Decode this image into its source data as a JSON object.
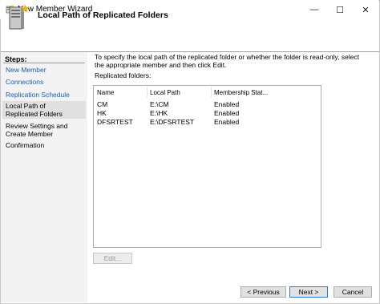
{
  "window": {
    "title": "New Member Wizard",
    "controls": {
      "minimize": "—",
      "maximize": "☐",
      "close": "✕"
    }
  },
  "header": {
    "title": "Local Path of Replicated Folders",
    "icon": "server-icon"
  },
  "steps": {
    "heading": "Steps:",
    "items": [
      {
        "label": "New Member",
        "style": "link"
      },
      {
        "label": "Connections",
        "style": "link"
      },
      {
        "label": "Replication Schedule",
        "style": "link"
      },
      {
        "label": "Local Path of Replicated Folders",
        "style": "current"
      },
      {
        "label": "Review Settings and Create Member",
        "style": "plain"
      },
      {
        "label": "Confirmation",
        "style": "plain"
      }
    ]
  },
  "content": {
    "instructions": "To specify the local path of the replicated folder or whether the folder is read-only, select the appropriate member and then click Edit.",
    "list_label": "Replicated folders:",
    "columns": [
      "Name",
      "Local Path",
      "Membership Stat..."
    ],
    "rows": [
      {
        "name": "CM",
        "path": "E:\\CM",
        "status": "Enabled"
      },
      {
        "name": "HK",
        "path": "E:\\HK",
        "status": "Enabled"
      },
      {
        "name": "DFSRTEST",
        "path": "E:\\DFSRTEST",
        "status": "Enabled"
      }
    ],
    "edit_label": "Edit..."
  },
  "footer": {
    "previous_label": "< Previous",
    "next_label": "Next >",
    "cancel_label": "Cancel"
  },
  "colors": {
    "link": "#1a5fb4",
    "accent_border": "#2a78d4",
    "steps_background": "#f3f3f3"
  }
}
